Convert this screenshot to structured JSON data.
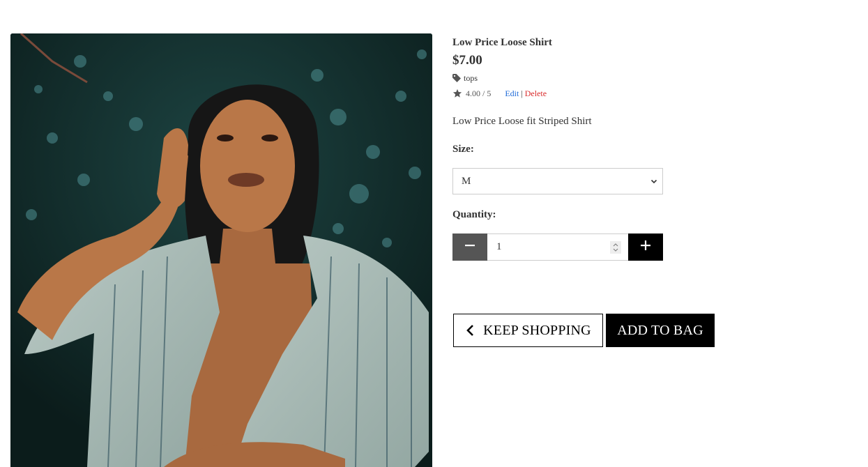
{
  "product": {
    "name": "Low Price Loose Shirt",
    "price": "$7.00",
    "category": "tops",
    "rating": "4.00 / 5",
    "edit_label": "Edit",
    "separator": "|",
    "delete_label": "Delete",
    "description": "Low Price Loose fit Striped Shirt"
  },
  "size": {
    "label": "Size:",
    "selected": "M"
  },
  "quantity": {
    "label": "Quantity:",
    "value": "1"
  },
  "actions": {
    "keep_shopping": "KEEP SHOPPING",
    "add_to_bag": "ADD TO BAG"
  },
  "icons": {
    "tag": "tag-icon",
    "star": "star-icon",
    "chevron": "chevron-down-icon",
    "minus": "minus-icon",
    "plus": "plus-icon",
    "back": "chevron-left-icon"
  },
  "colors": {
    "edit_link": "#1e6ad8",
    "delete_link": "#d92b2b",
    "minus_button": "#555555",
    "plus_button": "#000000",
    "add_to_bag_bg": "#000000"
  }
}
